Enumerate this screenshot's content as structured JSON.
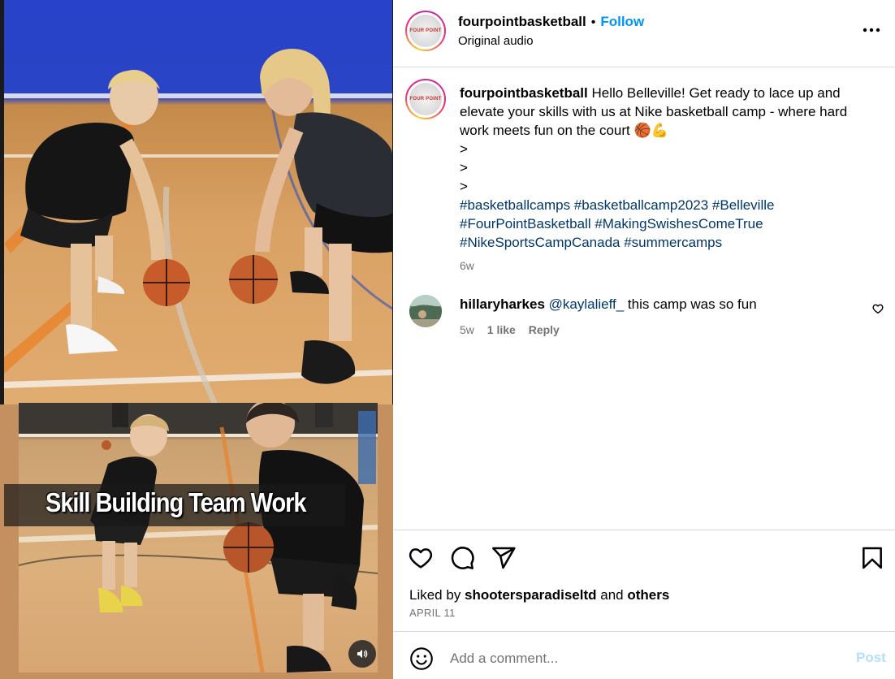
{
  "media": {
    "overlay_caption": "Skill Building Team Work",
    "mute_icon": "speaker-icon"
  },
  "header": {
    "username": "fourpointbasketball",
    "separator": "•",
    "follow_label": "Follow",
    "audio_label": "Original audio",
    "avatar_text": "FOUR POINT",
    "more_icon": "more-options-icon"
  },
  "post_caption": {
    "username": "fourpointbasketball",
    "text_line1": " Hello Belleville! Get ready to lace up and",
    "text_line2": "elevate your skills with us at Nike basketball camp - where hard",
    "text_line3": "work meets fun on the court ",
    "emoji": "🏀💪",
    "breaks": [
      ">",
      ">",
      ">"
    ],
    "hashtags_line1": "#basketballcamps #basketballcamp2023 #Belleville",
    "hashtags_line2": "#FourPointBasketball #MakingSwishesComeTrue",
    "hashtags_line3": "#NikeSportsCampCanada #summercamps",
    "age": "6w"
  },
  "comments": [
    {
      "username": "hillaryharkes",
      "mention": "@kaylalieff_",
      "text": " this camp was so fun",
      "age": "5w",
      "likes": "1 like",
      "reply_label": "Reply"
    }
  ],
  "footer": {
    "liked_by_prefix": "Liked by ",
    "liked_by_user": "shootersparadiseltd",
    "liked_by_middle": " and ",
    "liked_by_others": "others",
    "date": "APRIL 11",
    "comment_placeholder": "Add a comment...",
    "post_label": "Post"
  },
  "colors": {
    "link_blue": "#0095f6",
    "hashtag_blue": "#00376b",
    "muted_gray": "#737373",
    "post_disabled": "#b2dffc"
  }
}
